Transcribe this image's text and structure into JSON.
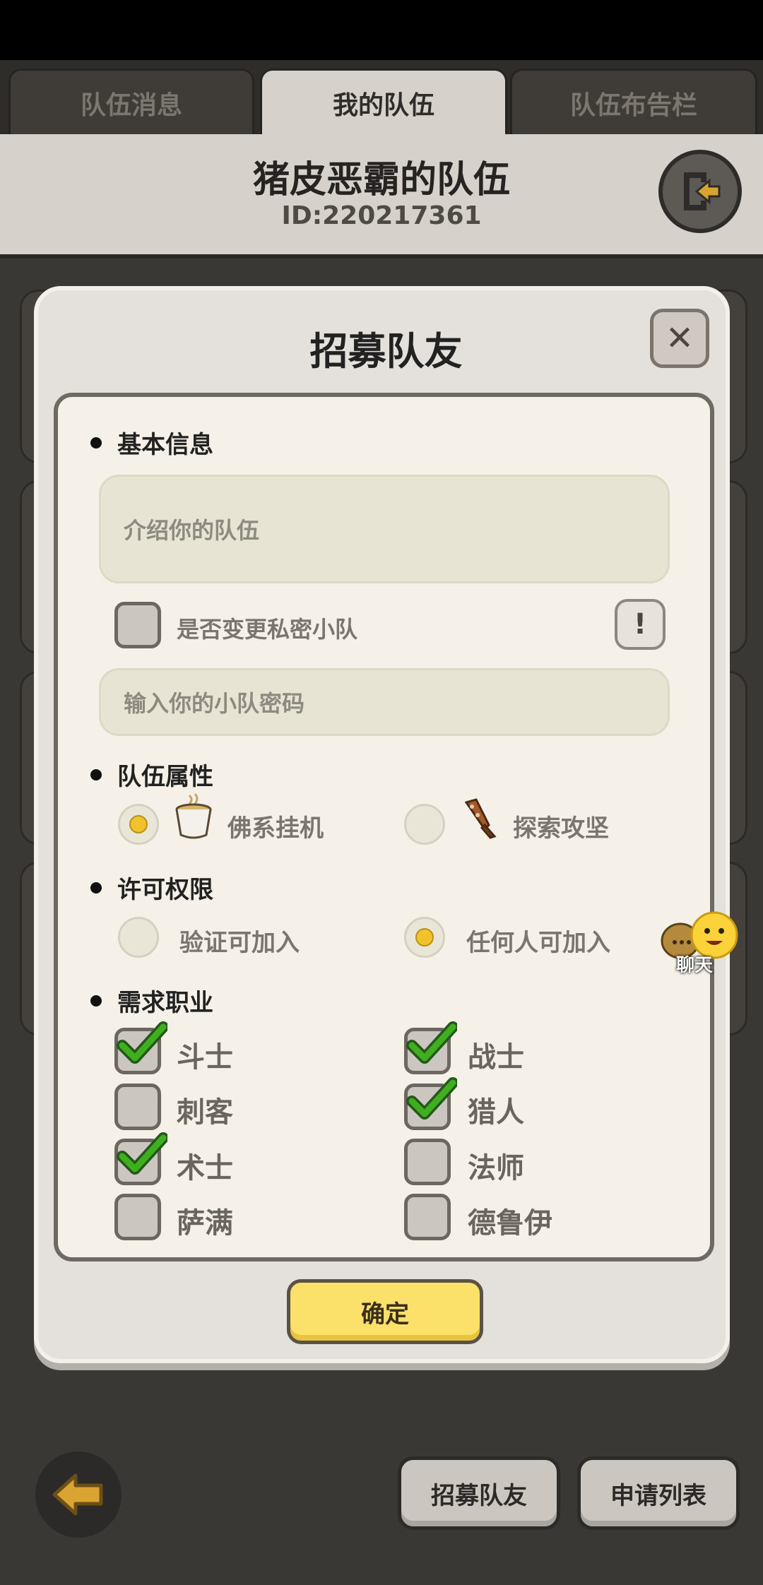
{
  "tabs": [
    {
      "label": "队伍消息",
      "active": false
    },
    {
      "label": "我的队伍",
      "active": true
    },
    {
      "label": "队伍布告栏",
      "active": false
    }
  ],
  "team": {
    "name": "猪皮恶霸的队伍",
    "id": "ID:220217361"
  },
  "modal": {
    "title": "招募队友",
    "basic_info": {
      "title": "基本信息",
      "intro_placeholder": "介绍你的队伍",
      "private_label": "是否变更私密小队",
      "private_checked": false,
      "info_glyph": "!",
      "password_placeholder": "输入你的小队密码"
    },
    "attributes": {
      "title": "队伍属性",
      "options": [
        {
          "label": "佛系挂机",
          "icon": "tea-cup-icon",
          "selected": true
        },
        {
          "label": "探索攻坚",
          "icon": "club-icon",
          "selected": false
        }
      ]
    },
    "permission": {
      "title": "许可权限",
      "options": [
        {
          "label": "验证可加入",
          "selected": false
        },
        {
          "label": "任何人可加入",
          "selected": true
        }
      ]
    },
    "jobs": {
      "title": "需求职业",
      "items": [
        {
          "label": "斗士",
          "checked": true
        },
        {
          "label": "战士",
          "checked": true
        },
        {
          "label": "刺客",
          "checked": false
        },
        {
          "label": "猎人",
          "checked": true
        },
        {
          "label": "术士",
          "checked": true
        },
        {
          "label": "法师",
          "checked": false
        },
        {
          "label": "萨满",
          "checked": false
        },
        {
          "label": "德鲁伊",
          "checked": false
        }
      ]
    },
    "confirm_label": "确定",
    "close_glyph": "✕"
  },
  "chat": {
    "label": "聊天"
  },
  "bottom": {
    "recruit_label": "招募队友",
    "apply_list_label": "申请列表"
  },
  "colors": {
    "accent_yellow": "#fbe06a",
    "check_green": "#3fae1f",
    "radio_dot": "#f2c22c"
  }
}
